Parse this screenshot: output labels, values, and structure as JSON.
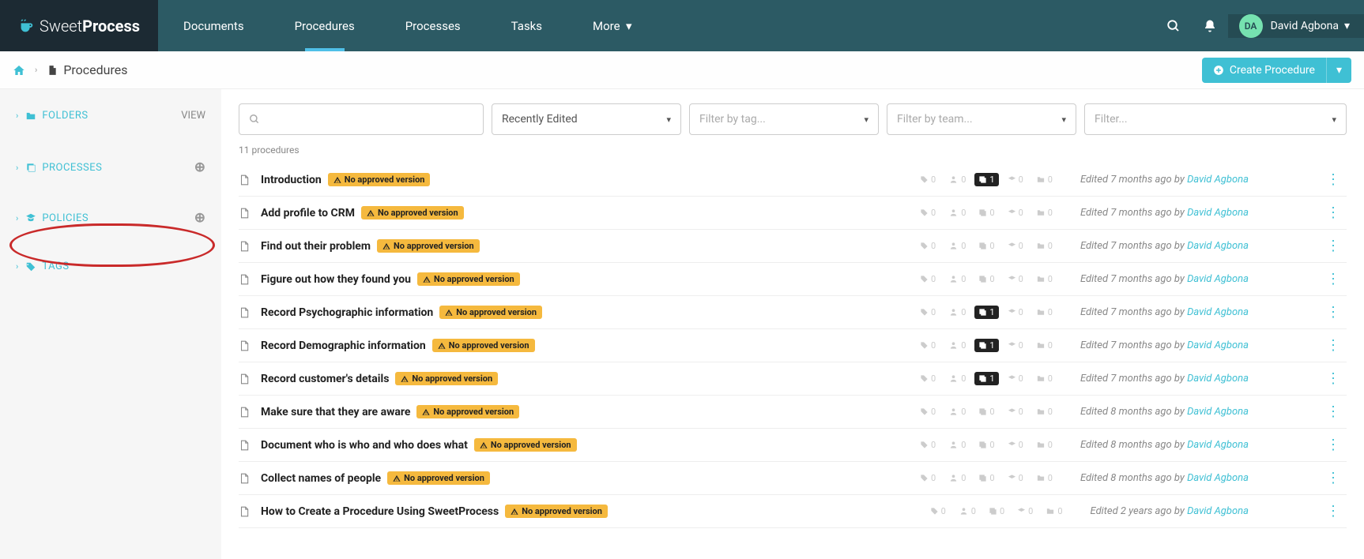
{
  "brand": {
    "part1": "Sweet",
    "part2": "Process"
  },
  "nav": {
    "documents": "Documents",
    "procedures": "Procedures",
    "processes": "Processes",
    "tasks": "Tasks",
    "more": "More"
  },
  "user": {
    "initials": "DA",
    "name": "David Agbona"
  },
  "breadcrumb": {
    "title": "Procedures"
  },
  "create_btn": "Create Procedure",
  "sidebar": {
    "folders": {
      "label": "FOLDERS",
      "action": "VIEW"
    },
    "processes": {
      "label": "PROCESSES"
    },
    "policies": {
      "label": "POLICIES"
    },
    "tags": {
      "label": "TAGS"
    }
  },
  "filters": {
    "sort": "Recently Edited",
    "tag_ph": "Filter by tag...",
    "team_ph": "Filter by team...",
    "filter_ph": "Filter..."
  },
  "count_label": "11 procedures",
  "badge_text": "No approved version",
  "edited_prefix": "Edited ",
  "edited_by": " by ",
  "author": "David Agbona",
  "rows": [
    {
      "title": "Introduction",
      "when": "7 months ago",
      "link_active": true
    },
    {
      "title": "Add profile to CRM",
      "when": "7 months ago",
      "link_active": false
    },
    {
      "title": "Find out their problem",
      "when": "7 months ago",
      "link_active": false
    },
    {
      "title": "Figure out how they found you",
      "when": "7 months ago",
      "link_active": false
    },
    {
      "title": "Record Psychographic information",
      "when": "7 months ago",
      "link_active": true
    },
    {
      "title": "Record Demographic information",
      "when": "7 months ago",
      "link_active": true
    },
    {
      "title": "Record customer's details",
      "when": "7 months ago",
      "link_active": true
    },
    {
      "title": "Make sure that they are aware",
      "when": "8 months ago",
      "link_active": false
    },
    {
      "title": "Document who is who and who does what",
      "when": "8 months ago",
      "link_active": false
    },
    {
      "title": "Collect names of people",
      "when": "8 months ago",
      "link_active": false
    },
    {
      "title": "How to Create a Procedure Using SweetProcess",
      "when": "2 years ago",
      "link_active": false
    }
  ],
  "stat_default": "0",
  "stat_link_val": "1"
}
